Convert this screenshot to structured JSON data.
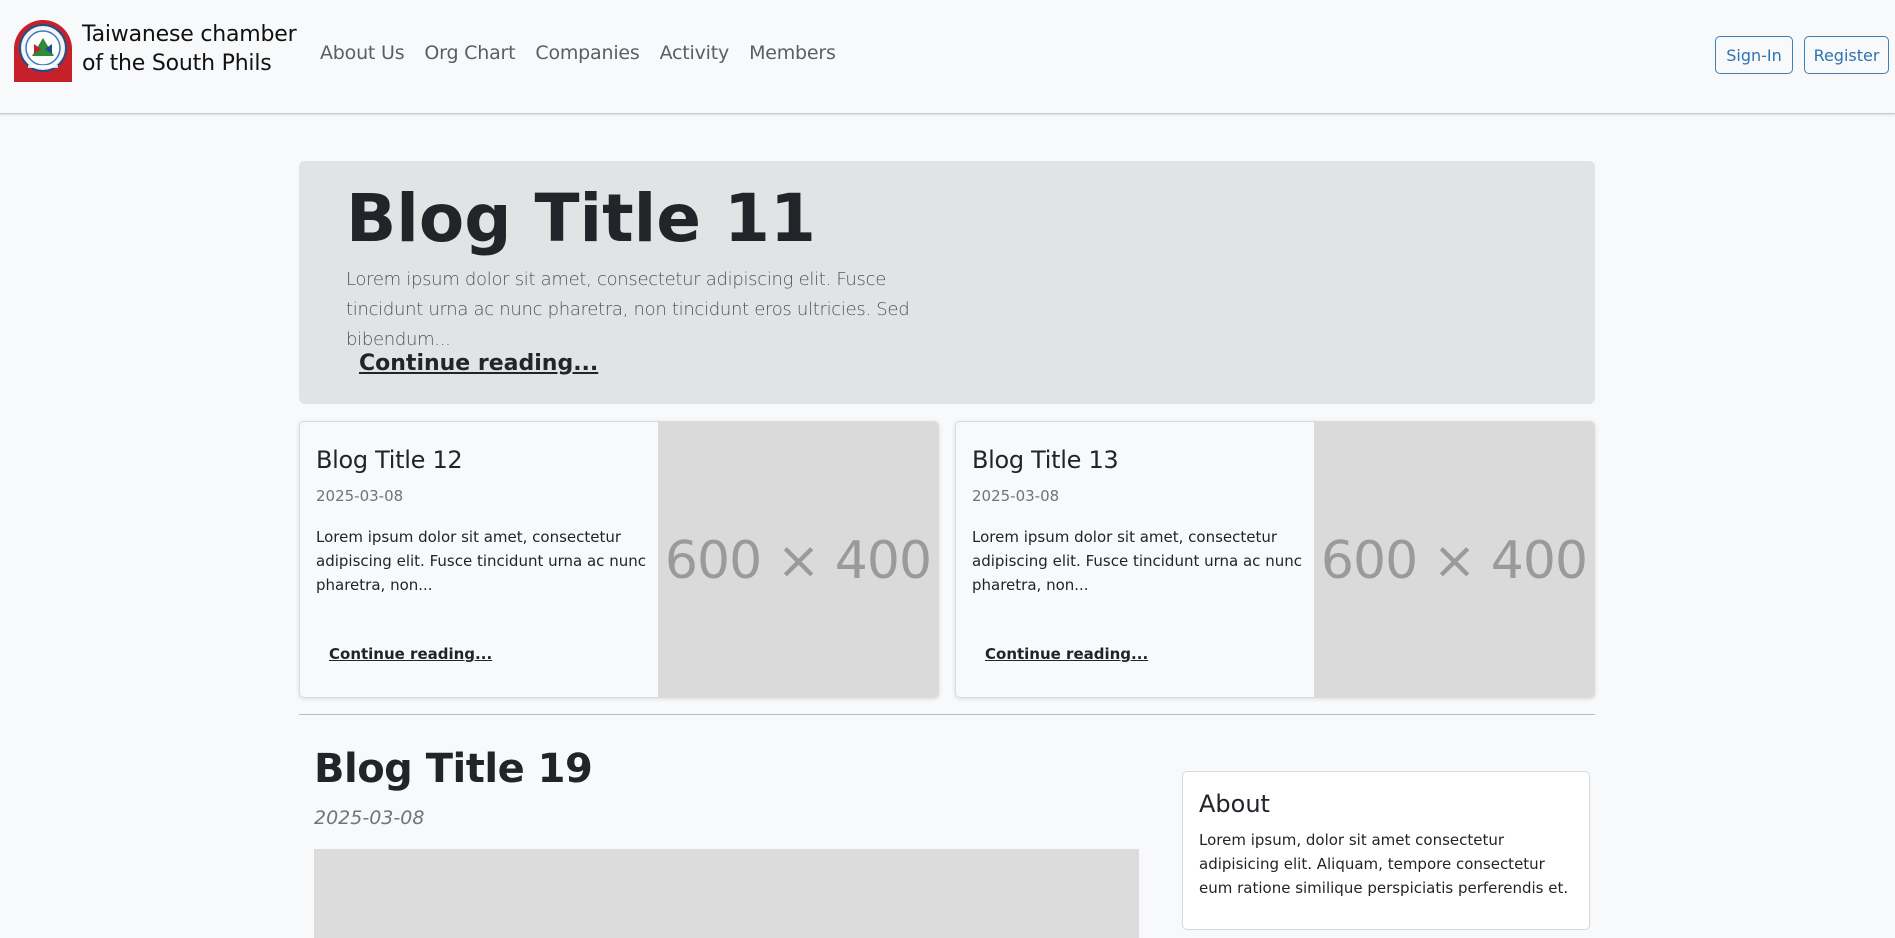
{
  "navbar": {
    "brand_line1": "Taiwanese chamber",
    "brand_line2": "of the South Phils",
    "links": [
      "About Us",
      "Org Chart",
      "Companies",
      "Activity",
      "Members"
    ],
    "signin_label": "Sign-In",
    "register_label": "Register"
  },
  "hero": {
    "title": "Blog Title 11",
    "excerpt": "Lorem ipsum dolor sit amet, consectetur adipiscing elit. Fusce tincidunt urna ac nunc pharetra, non tincidunt eros ultricies. Sed bibendum...",
    "link_label": "Continue reading..."
  },
  "cards": [
    {
      "title": "Blog Title 12",
      "date": "2025-03-08",
      "excerpt": "Lorem ipsum dolor sit amet, consectetur adipiscing elit. Fusce tincidunt urna ac nunc pharetra, non...",
      "link_label": "Continue reading...",
      "thumb_label": "600 × 400"
    },
    {
      "title": "Blog Title 13",
      "date": "2025-03-08",
      "excerpt": "Lorem ipsum dolor sit amet, consectetur adipiscing elit. Fusce tincidunt urna ac nunc pharetra, non...",
      "link_label": "Continue reading...",
      "thumb_label": "600 × 400"
    }
  ],
  "post": {
    "title": "Blog Title 19",
    "date": "2025-03-08"
  },
  "about": {
    "title": "About",
    "text": "Lorem ipsum, dolor sit amet consectetur adipisicing elit. Aliquam, tempore consectetur eum ratione similique perspiciatis perferendis et."
  },
  "colors": {
    "accent": "#2f72b0",
    "logo_red": "#c8202a",
    "hero_bg": "#e2e3e5",
    "page_bg": "#f8f9fa"
  },
  "icons": {
    "logo": "chamber-seal-logo"
  }
}
